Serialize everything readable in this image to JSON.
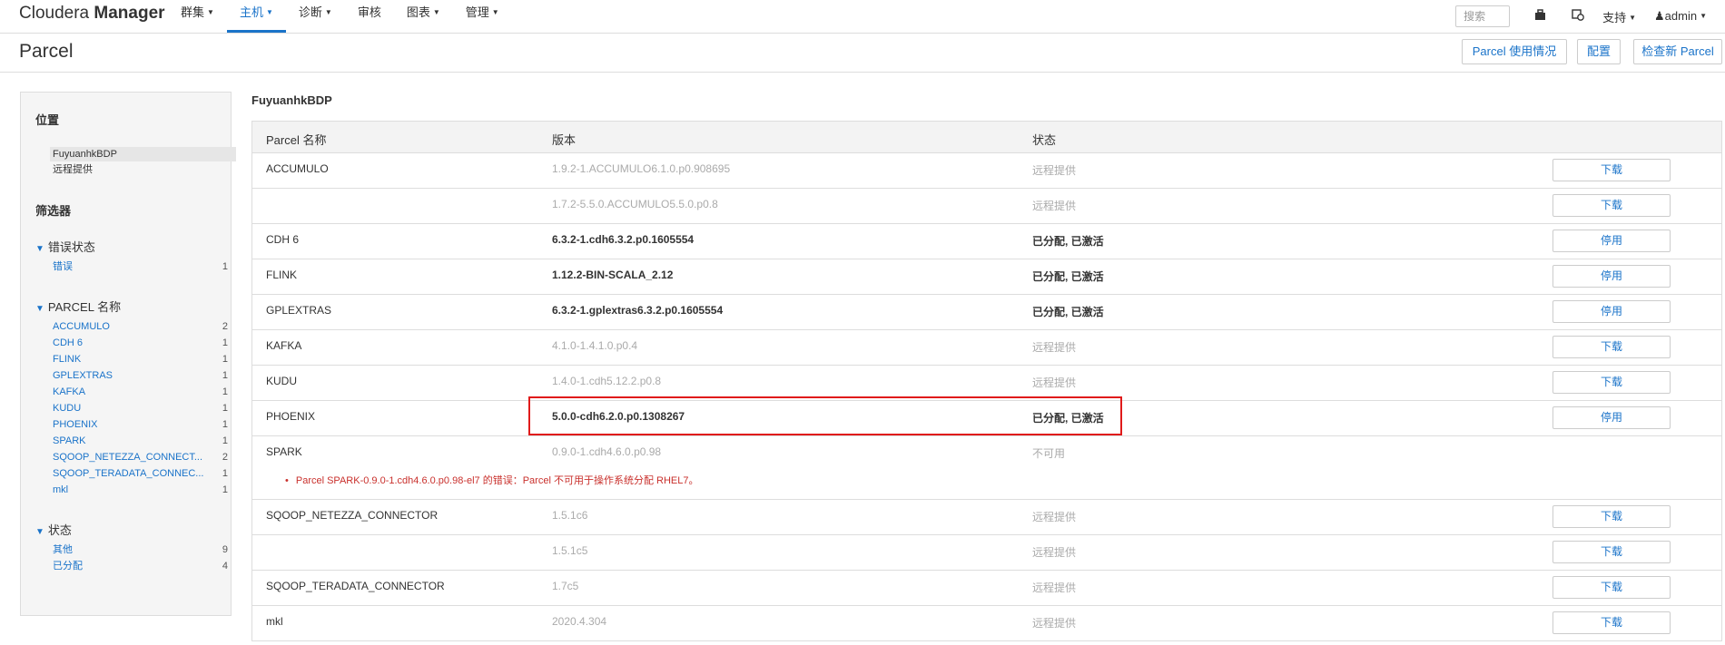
{
  "app": {
    "brand_regular": "Cloudera ",
    "brand_bold": "Manager"
  },
  "nav": [
    {
      "label": "群集",
      "caret": true,
      "active": false
    },
    {
      "label": "主机",
      "caret": true,
      "active": true
    },
    {
      "label": "诊断",
      "caret": true,
      "active": false
    },
    {
      "label": "审核",
      "caret": false,
      "active": false
    },
    {
      "label": "图表",
      "caret": true,
      "active": false
    },
    {
      "label": "管理",
      "caret": true,
      "active": false
    }
  ],
  "topbar": {
    "search_placeholder": "搜索",
    "support": "支持",
    "user": "admin"
  },
  "page": {
    "title": "Parcel",
    "btn_usage": "Parcel 使用情况",
    "btn_config": "配置",
    "btn_check": "检查新 Parcel"
  },
  "sidebar": {
    "location_title": "位置",
    "locations": [
      "FuyuanhkBDP",
      "远程提供"
    ],
    "filter_title": "筛选器",
    "groups": [
      {
        "title": "错误状态",
        "items": [
          {
            "label": "错误",
            "count": "1"
          }
        ]
      },
      {
        "title": "PARCEL 名称",
        "items": [
          {
            "label": "ACCUMULO",
            "count": "2"
          },
          {
            "label": "CDH 6",
            "count": "1"
          },
          {
            "label": "FLINK",
            "count": "1"
          },
          {
            "label": "GPLEXTRAS",
            "count": "1"
          },
          {
            "label": "KAFKA",
            "count": "1"
          },
          {
            "label": "KUDU",
            "count": "1"
          },
          {
            "label": "PHOENIX",
            "count": "1"
          },
          {
            "label": "SPARK",
            "count": "1"
          },
          {
            "label": "SQOOP_NETEZZA_CONNECT...",
            "count": "2"
          },
          {
            "label": "SQOOP_TERADATA_CONNEC...",
            "count": "1"
          },
          {
            "label": "mkl",
            "count": "1"
          }
        ]
      },
      {
        "title": "状态",
        "items": [
          {
            "label": "其他",
            "count": "9"
          },
          {
            "label": "已分配",
            "count": "4"
          }
        ]
      }
    ]
  },
  "main": {
    "cluster_title": "FuyuanhkBDP",
    "headers": {
      "name": "Parcel 名称",
      "version": "版本",
      "status": "状态"
    },
    "rows": [
      {
        "name": "ACCUMULO",
        "version": "1.9.2-1.ACCUMULO6.1.0.p0.908695",
        "status": "远程提供",
        "action": "下载",
        "active": false
      },
      {
        "name": "",
        "version": "1.7.2-5.5.0.ACCUMULO5.5.0.p0.8",
        "status": "远程提供",
        "action": "下载",
        "active": false
      },
      {
        "name": "CDH 6",
        "version": "6.3.2-1.cdh6.3.2.p0.1605554",
        "status": "已分配, 已激活",
        "action": "停用",
        "active": true
      },
      {
        "name": "FLINK",
        "version": "1.12.2-BIN-SCALA_2.12",
        "status": "已分配, 已激活",
        "action": "停用",
        "active": true
      },
      {
        "name": "GPLEXTRAS",
        "version": "6.3.2-1.gplextras6.3.2.p0.1605554",
        "status": "已分配, 已激活",
        "action": "停用",
        "active": true
      },
      {
        "name": "KAFKA",
        "version": "4.1.0-1.4.1.0.p0.4",
        "status": "远程提供",
        "action": "下载",
        "active": false
      },
      {
        "name": "KUDU",
        "version": "1.4.0-1.cdh5.12.2.p0.8",
        "status": "远程提供",
        "action": "下载",
        "active": false
      },
      {
        "name": "PHOENIX",
        "version": "5.0.0-cdh6.2.0.p0.1308267",
        "status": "已分配, 已激活",
        "action": "停用",
        "active": true
      },
      {
        "name": "SPARK",
        "version": "0.9.0-1.cdh4.6.0.p0.98",
        "status": "不可用",
        "action": "",
        "active": false,
        "error": "Parcel SPARK-0.9.0-1.cdh4.6.0.p0.98-el7 的错误：Parcel 不可用于操作系统分配 RHEL7。"
      },
      {
        "name": "SQOOP_NETEZZA_CONNECTOR",
        "version": "1.5.1c6",
        "status": "远程提供",
        "action": "下载",
        "active": false
      },
      {
        "name": "",
        "version": "1.5.1c5",
        "status": "远程提供",
        "action": "下载",
        "active": false
      },
      {
        "name": "SQOOP_TERADATA_CONNECTOR",
        "version": "1.7c5",
        "status": "远程提供",
        "action": "下载",
        "active": false
      },
      {
        "name": "mkl",
        "version": "2020.4.304",
        "status": "远程提供",
        "action": "下载",
        "active": false
      }
    ]
  },
  "colors": {
    "accent": "#1a73c9",
    "error": "#c9302c",
    "highlight": "#e01b1b"
  }
}
